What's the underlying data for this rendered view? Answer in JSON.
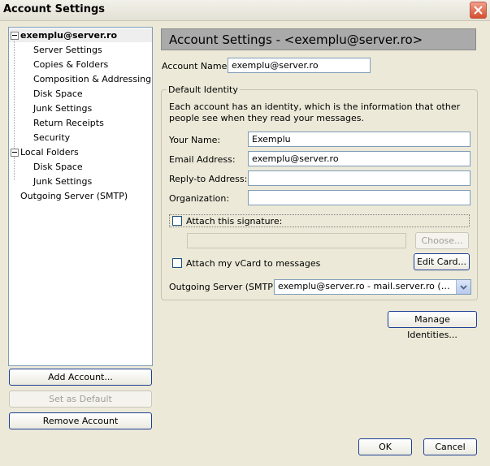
{
  "window": {
    "title": "Account Settings"
  },
  "tree": {
    "items": [
      {
        "label": "exemplu@server.ro",
        "level": 0,
        "expanded": true,
        "selected": true
      },
      {
        "label": "Server Settings",
        "level": 1
      },
      {
        "label": "Copies & Folders",
        "level": 1
      },
      {
        "label": "Composition & Addressing",
        "level": 1
      },
      {
        "label": "Disk Space",
        "level": 1
      },
      {
        "label": "Junk Settings",
        "level": 1
      },
      {
        "label": "Return Receipts",
        "level": 1
      },
      {
        "label": "Security",
        "level": 1
      },
      {
        "label": "Local Folders",
        "level": 0,
        "expanded": true
      },
      {
        "label": "Disk Space",
        "level": 1
      },
      {
        "label": "Junk Settings",
        "level": 1
      },
      {
        "label": "Outgoing Server (SMTP)",
        "level": 0
      }
    ]
  },
  "left_buttons": {
    "add_account": "Add Account...",
    "set_default": "Set as Default",
    "remove_account": "Remove Account"
  },
  "panel": {
    "header": "Account Settings - <exemplu@server.ro>",
    "account_name_label": "Account Name:",
    "account_name_value": "exemplu@server.ro",
    "identity": {
      "legend": "Default Identity",
      "description": "Each account has an identity, which is the information that other people see when they read your messages.",
      "your_name_label": "Your Name:",
      "your_name_value": "Exemplu",
      "email_label": "Email Address:",
      "email_value": "exemplu@server.ro",
      "reply_to_label": "Reply-to Address:",
      "reply_to_value": "",
      "organization_label": "Organization:",
      "organization_value": "",
      "attach_signature_label": "Attach this signature:",
      "signature_path": "",
      "choose_label": "Choose...",
      "attach_vcard_label": "Attach my vCard to messages",
      "edit_card_label": "Edit Card...",
      "smtp_label": "Outgoing Server (SMTP):",
      "smtp_value": "exemplu@server.ro - mail.server.ro (Default)"
    },
    "manage_identities_label": "Manage Identities..."
  },
  "footer": {
    "ok": "OK",
    "cancel": "Cancel"
  }
}
